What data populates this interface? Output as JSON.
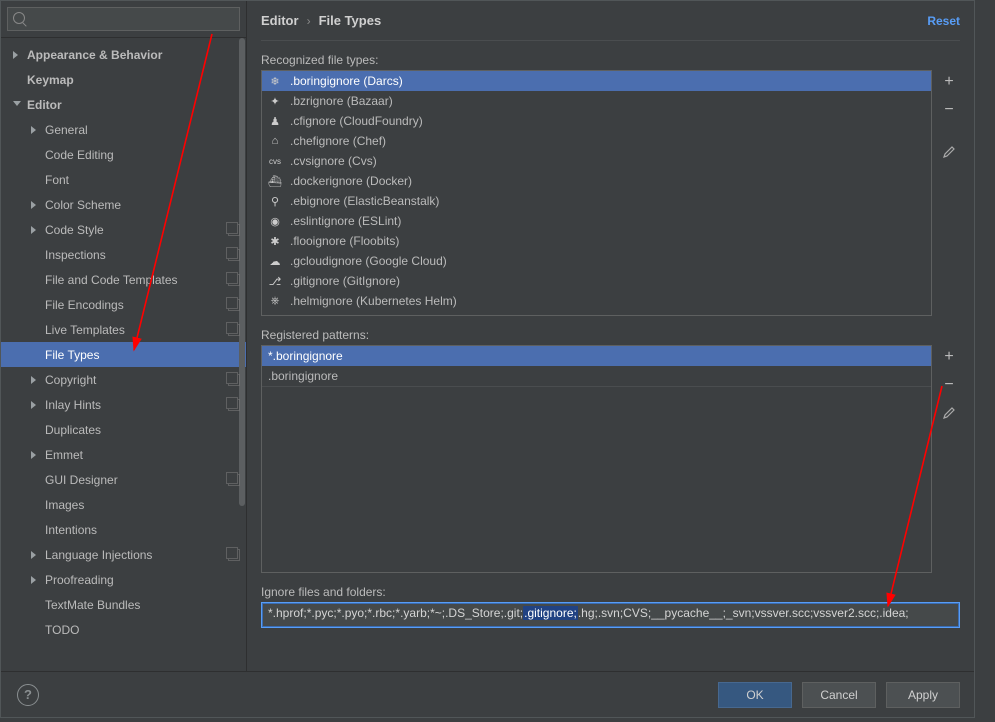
{
  "search": {
    "placeholder": ""
  },
  "breadcrumb": {
    "parent": "Editor",
    "current": "File Types",
    "reset": "Reset"
  },
  "sidebar": {
    "items": [
      {
        "label": "Appearance & Behavior",
        "depth": 0,
        "caret": "right",
        "bold": true
      },
      {
        "label": "Keymap",
        "depth": 0,
        "caret": "none",
        "bold": true
      },
      {
        "label": "Editor",
        "depth": 0,
        "caret": "down",
        "bold": true
      },
      {
        "label": "General",
        "depth": 1,
        "caret": "right"
      },
      {
        "label": "Code Editing",
        "depth": 1,
        "caret": "none"
      },
      {
        "label": "Font",
        "depth": 1,
        "caret": "none"
      },
      {
        "label": "Color Scheme",
        "depth": 1,
        "caret": "right"
      },
      {
        "label": "Code Style",
        "depth": 1,
        "caret": "right",
        "copy": true
      },
      {
        "label": "Inspections",
        "depth": 1,
        "caret": "none",
        "copy": true
      },
      {
        "label": "File and Code Templates",
        "depth": 1,
        "caret": "none",
        "copy": true
      },
      {
        "label": "File Encodings",
        "depth": 1,
        "caret": "none",
        "copy": true
      },
      {
        "label": "Live Templates",
        "depth": 1,
        "caret": "none",
        "copy": true
      },
      {
        "label": "File Types",
        "depth": 1,
        "caret": "none",
        "selected": true
      },
      {
        "label": "Copyright",
        "depth": 1,
        "caret": "right",
        "copy": true
      },
      {
        "label": "Inlay Hints",
        "depth": 1,
        "caret": "right",
        "copy": true
      },
      {
        "label": "Duplicates",
        "depth": 1,
        "caret": "none"
      },
      {
        "label": "Emmet",
        "depth": 1,
        "caret": "right"
      },
      {
        "label": "GUI Designer",
        "depth": 1,
        "caret": "none",
        "copy": true
      },
      {
        "label": "Images",
        "depth": 1,
        "caret": "none"
      },
      {
        "label": "Intentions",
        "depth": 1,
        "caret": "none"
      },
      {
        "label": "Language Injections",
        "depth": 1,
        "caret": "right",
        "copy": true
      },
      {
        "label": "Proofreading",
        "depth": 1,
        "caret": "right"
      },
      {
        "label": "TextMate Bundles",
        "depth": 1,
        "caret": "none"
      },
      {
        "label": "TODO",
        "depth": 1,
        "caret": "none"
      }
    ]
  },
  "labels": {
    "recognized": "Recognized file types:",
    "patterns": "Registered patterns:",
    "ignore": "Ignore files and folders:"
  },
  "filetypes": [
    {
      "label": ".boringignore (Darcs)",
      "icon": "❄",
      "selected": true
    },
    {
      "label": ".bzrignore (Bazaar)",
      "icon": "✦"
    },
    {
      "label": ".cfignore (CloudFoundry)",
      "icon": "♟"
    },
    {
      "label": ".chefignore (Chef)",
      "icon": "⌂"
    },
    {
      "label": ".cvsignore (Cvs)",
      "icon": "cvs",
      "small": true
    },
    {
      "label": ".dockerignore (Docker)",
      "icon": "⛴"
    },
    {
      "label": ".ebignore (ElasticBeanstalk)",
      "icon": "⚲"
    },
    {
      "label": ".eslintignore (ESLint)",
      "icon": "◉"
    },
    {
      "label": ".flooignore (Floobits)",
      "icon": "✱"
    },
    {
      "label": ".gcloudignore (Google Cloud)",
      "icon": "☁"
    },
    {
      "label": ".gitignore (GitIgnore)",
      "icon": "⎇"
    },
    {
      "label": ".helmignore (Kubernetes Helm)",
      "icon": "⎈"
    }
  ],
  "patterns": [
    {
      "label": "*.boringignore",
      "selected": true
    },
    {
      "label": ".boringignore"
    }
  ],
  "ignore": {
    "prefix": "*.hprof;*.pyc;*.pyo;*.rbc;*.yarb;*~;.DS_Store;.git;",
    "selected": ".gitignore;",
    "suffix": ".hg;.svn;CVS;__pycache__;_svn;vssver.scc;vssver2.scc;.idea;"
  },
  "buttons": {
    "ok": "OK",
    "cancel": "Cancel",
    "apply": "Apply",
    "help": "?"
  }
}
